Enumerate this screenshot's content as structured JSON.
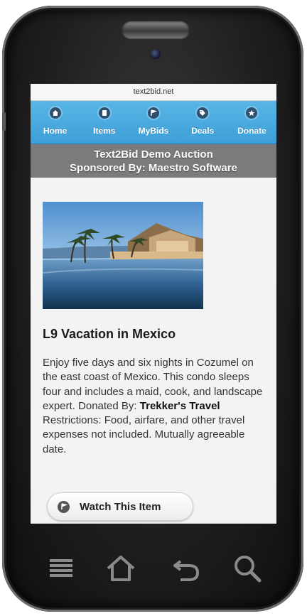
{
  "browser": {
    "url": "text2bid.net"
  },
  "nav": [
    {
      "label": "Home",
      "icon": "home-icon"
    },
    {
      "label": "Items",
      "icon": "items-icon"
    },
    {
      "label": "MyBids",
      "icon": "flag-icon"
    },
    {
      "label": "Deals",
      "icon": "tag-icon"
    },
    {
      "label": "Donate",
      "icon": "star-icon"
    }
  ],
  "banner": {
    "line1": "Text2Bid Demo Auction",
    "line2": "Sponsored By: Maestro Software"
  },
  "item": {
    "title": "L9 Vacation in Mexico",
    "description": "Enjoy five days and six nights in Cozumel on the east coast of Mexico. This condo sleeps four and includes a maid, cook, and landscape expert.",
    "donated_label": "Donated By:",
    "donor": "Trekker's Travel",
    "restrictions": "Restrictions: Food, airfare, and other travel expenses not included. Mutually agreeable date.",
    "watch_label": "Watch This Item"
  },
  "hardware_keys": [
    "menu-icon",
    "home-icon",
    "back-icon",
    "search-icon"
  ],
  "colors": {
    "nav_blue": "#4aa9df",
    "banner_gray": "#7b7b7b"
  }
}
